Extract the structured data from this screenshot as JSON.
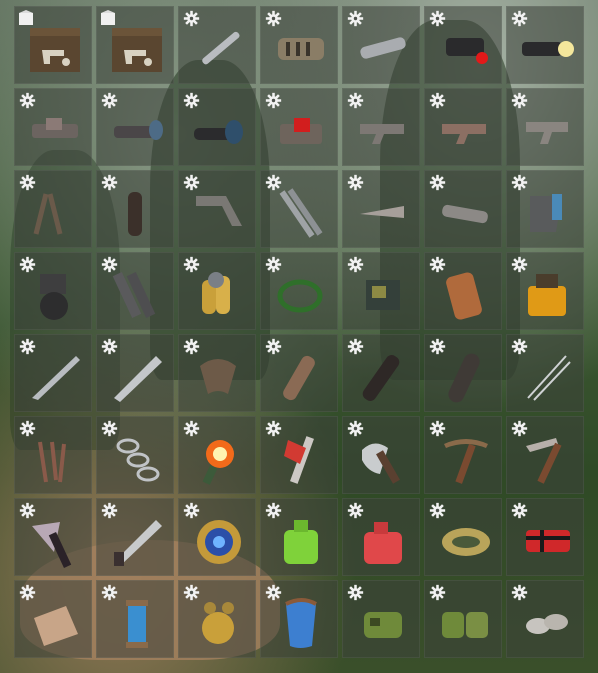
{
  "inventory": {
    "rows": [
      [
        {
          "icon": "weapon-crate-icon",
          "badge": "crate-badge-icon"
        },
        {
          "icon": "weapon-crate-icon",
          "badge": "crate-badge-icon"
        },
        {
          "icon": "silencer-icon",
          "badge": "gear-icon"
        },
        {
          "icon": "muzzle-brake-icon",
          "badge": "gear-icon"
        },
        {
          "icon": "muzzle-boost-icon",
          "badge": "gear-icon"
        },
        {
          "icon": "laser-sight-icon",
          "badge": "gear-icon"
        },
        {
          "icon": "weapon-flashlight-icon",
          "badge": "gear-icon"
        }
      ],
      [
        {
          "icon": "holo-sight-icon",
          "badge": "gear-icon"
        },
        {
          "icon": "scope-8x-icon",
          "badge": "gear-icon"
        },
        {
          "icon": "scope-16x-icon",
          "badge": "gear-icon"
        },
        {
          "icon": "red-dot-sight-icon",
          "badge": "gear-icon"
        },
        {
          "icon": "rifle-body-icon",
          "badge": "gear-icon"
        },
        {
          "icon": "smg-body-icon",
          "badge": "gear-icon"
        },
        {
          "icon": "semi-auto-body-icon",
          "badge": "gear-icon"
        }
      ],
      [
        {
          "icon": "bipod-icon",
          "badge": "gear-icon"
        },
        {
          "icon": "grip-icon",
          "badge": "gear-icon"
        },
        {
          "icon": "stock-icon",
          "badge": "gear-icon"
        },
        {
          "icon": "metal-pipe-icon",
          "badge": "gear-icon"
        },
        {
          "icon": "metal-spring-icon",
          "badge": "gear-icon"
        },
        {
          "icon": "barrel-icon",
          "badge": "gear-icon"
        },
        {
          "icon": "sheet-metal-icon",
          "badge": "gear-icon"
        }
      ],
      [
        {
          "icon": "extended-magazine-icon",
          "badge": "gear-icon"
        },
        {
          "icon": "rail-mount-icon",
          "badge": "gear-icon"
        },
        {
          "icon": "brass-capsules-icon",
          "badge": "gear-icon"
        },
        {
          "icon": "rope-icon",
          "badge": "gear-icon"
        },
        {
          "icon": "tech-trash-icon",
          "badge": "gear-icon"
        },
        {
          "icon": "leather-roll-icon",
          "badge": "gear-icon"
        },
        {
          "icon": "fuel-canister-icon",
          "badge": "gear-icon"
        }
      ],
      [
        {
          "icon": "machete-blade-icon",
          "badge": "gear-icon"
        },
        {
          "icon": "saw-blade-icon",
          "badge": "gear-icon"
        },
        {
          "icon": "stone-hatchet-head-icon",
          "badge": "gear-icon"
        },
        {
          "icon": "knife-handle-icon",
          "badge": "gear-icon"
        },
        {
          "icon": "wooden-handle-icon",
          "badge": "gear-icon"
        },
        {
          "icon": "wrapped-grip-icon",
          "badge": "gear-icon"
        },
        {
          "icon": "barbed-wire-icon",
          "badge": "gear-icon"
        }
      ],
      [
        {
          "icon": "nails-icon",
          "badge": "gear-icon"
        },
        {
          "icon": "chain-icon",
          "badge": "gear-icon"
        },
        {
          "icon": "flare-icon",
          "badge": "gear-icon"
        },
        {
          "icon": "red-axe-icon",
          "badge": "gear-icon"
        },
        {
          "icon": "shovel-icon",
          "badge": "gear-icon"
        },
        {
          "icon": "pickaxe-icon",
          "badge": "gear-icon"
        },
        {
          "icon": "salvaged-pickaxe-icon",
          "badge": "gear-icon"
        }
      ],
      [
        {
          "icon": "hatchet-icon",
          "badge": "gear-icon"
        },
        {
          "icon": "serrated-blade-icon",
          "badge": "gear-icon"
        },
        {
          "icon": "tech-core-icon",
          "badge": "gear-icon"
        },
        {
          "icon": "green-jerrycan-icon",
          "badge": "gear-icon"
        },
        {
          "icon": "red-jerrycan-icon",
          "badge": "gear-icon"
        },
        {
          "icon": "ammo-belt-icon",
          "badge": "gear-icon"
        },
        {
          "icon": "plaid-bundle-icon",
          "badge": "gear-icon"
        }
      ],
      [
        {
          "icon": "cloth-icon",
          "badge": "gear-icon"
        },
        {
          "icon": "thread-spool-icon",
          "badge": "gear-icon"
        },
        {
          "icon": "brass-parts-icon",
          "badge": "gear-icon"
        },
        {
          "icon": "knee-pad-icon",
          "badge": "gear-icon"
        },
        {
          "icon": "camo-pouch-icon",
          "badge": "gear-icon"
        },
        {
          "icon": "camo-pouches-icon",
          "badge": "gear-icon"
        },
        {
          "icon": "metal-fittings-icon",
          "badge": "gear-icon"
        }
      ]
    ]
  }
}
